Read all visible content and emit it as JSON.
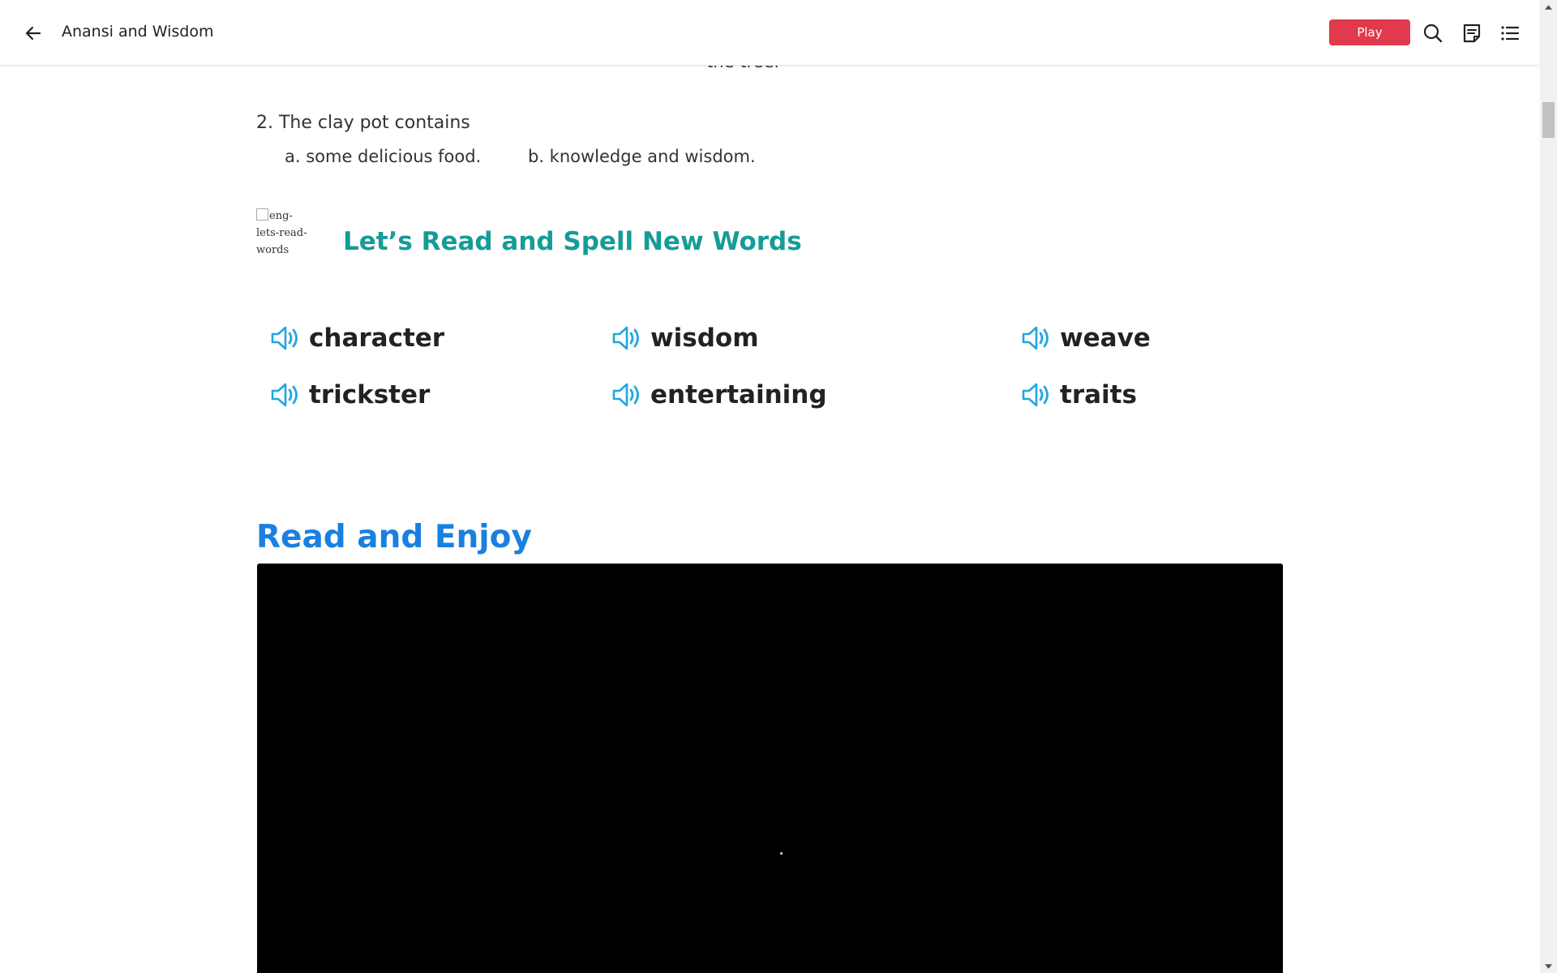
{
  "header": {
    "back_icon": "arrow-left-icon",
    "title": "Anansi and Wisdom",
    "play_label": "Play",
    "play_color": "#e03a4c",
    "icons": [
      "search-icon",
      "notes-icon",
      "list-menu-icon"
    ]
  },
  "quiz": {
    "clipped_text": "the tree.",
    "question": "2. The clay pot contains",
    "option_a": "a. some delicious food.",
    "option_b": "b. knowledge and wisdom."
  },
  "words_section": {
    "image_alt": "eng-lets-read-words",
    "title": "Let’s Read and Spell New Words",
    "title_color": "#169c96",
    "speaker_color": "#1ea7e1",
    "words": [
      "character",
      "wisdom",
      "weave",
      "trickster",
      "entertaining",
      "traits"
    ]
  },
  "read_section": {
    "title": "Read and Enjoy",
    "title_color": "#1a80e0"
  }
}
